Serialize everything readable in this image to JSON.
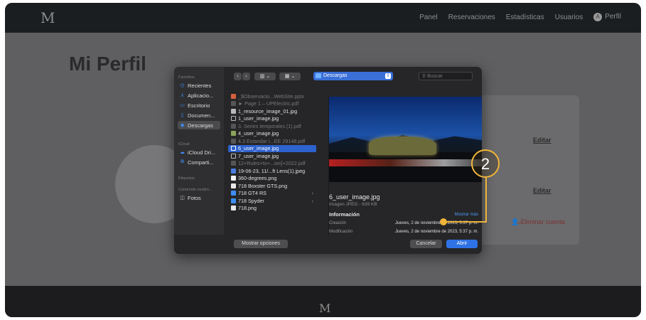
{
  "nav": {
    "logo": "M",
    "links": [
      "Panel",
      "Reservaciones",
      "Estadísticas",
      "Usuarios"
    ],
    "avatar_letter": "A",
    "profile": "Perfil"
  },
  "page": {
    "title": "Mi Perfil",
    "edit1": "Editar",
    "edit2": "Editar",
    "delete": "Eliminar cuenta",
    "footer_logo": "M"
  },
  "dialog": {
    "sidebar": {
      "favorites_heading": "Favoritos",
      "favorites": [
        "Recientes",
        "Aplicacio...",
        "Escritorio",
        "Documen...",
        "Descargas"
      ],
      "icloud_heading": "iCloud",
      "icloud": [
        "iCloud Dri...",
        "Comparti..."
      ],
      "tags_heading": "Etiquetas",
      "media_heading": "Contenido multim...",
      "media": [
        "Fotos"
      ]
    },
    "toolbar": {
      "back": "‹",
      "forward": "›",
      "view_columns": "▥ ⌄",
      "view_grid": "▦ ⌄",
      "location": "Descargas",
      "search_placeholder": "Buscar"
    },
    "files": [
      "_$Observacio...WebSite.pptx",
      "► Page 1 – UPElectric.pdf",
      "1_resource_image_01.jpg",
      "1_user_image.jpg",
      "3. Series temporales (1).pdf",
      "4_user_image.jpg",
      "4.3 Estandar I...EE 29148.pdf",
      "6_user_image.jpg",
      "7_user_image.jpg",
      "12+Rules+to+...ion]+2022.pdf",
      "19-06-23, 11/...ft Lens(1).jpeg",
      "360-degrees.png",
      "718 Boxster GTS.png",
      "718 GT4 RS",
      "718 Spyder",
      "718.png"
    ],
    "preview": {
      "name": "6_user_image.jpg",
      "kind": "Imagen JPEG - 639 KB",
      "info": "Información",
      "more": "Mostrar más",
      "created_label": "Creación",
      "created_value": "Jueves, 2 de noviembre de 2023, 5:37 p. m.",
      "modified_label": "Modificación",
      "modified_value": "Jueves, 2 de noviembre de 2023, 5:37 p. m."
    },
    "buttons": {
      "options": "Mostrar opciones",
      "cancel": "Cancelar",
      "open": "Abrir"
    }
  },
  "callout": {
    "number": "2",
    "color": "#f0b43a"
  }
}
